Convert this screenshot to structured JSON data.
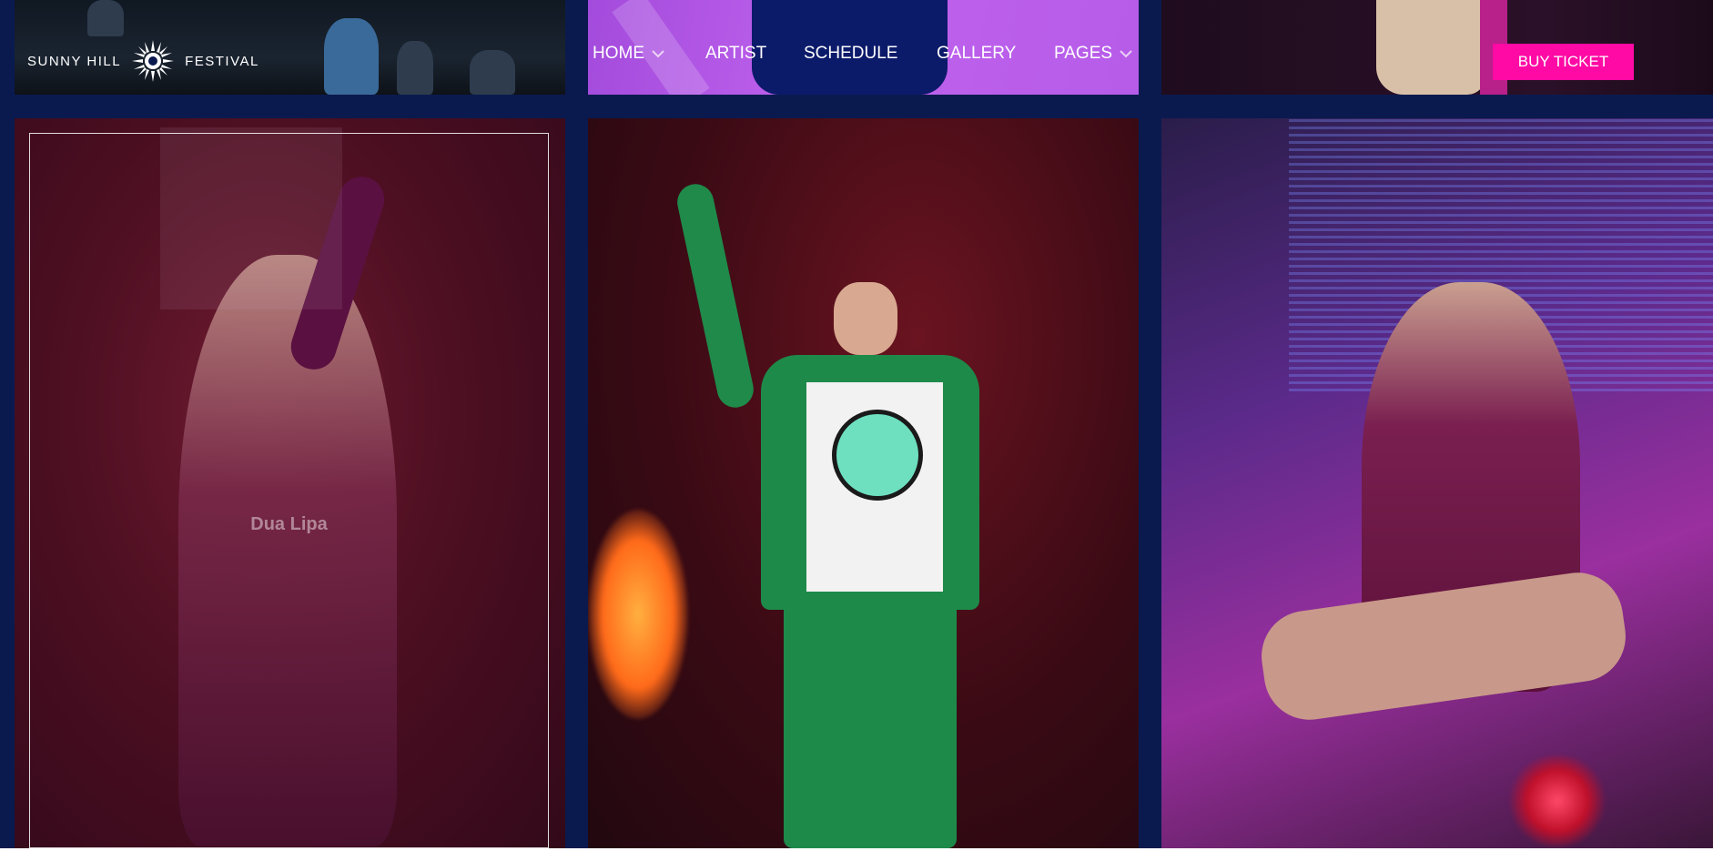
{
  "logo": {
    "left_text": "SUNNY HILL",
    "right_text": "FESTIVAL"
  },
  "nav": {
    "items": [
      {
        "label": "HOME",
        "has_dropdown": true
      },
      {
        "label": "ARTIST",
        "has_dropdown": false
      },
      {
        "label": "SCHEDULE",
        "has_dropdown": false
      },
      {
        "label": "GALLERY",
        "has_dropdown": false
      },
      {
        "label": "PAGES",
        "has_dropdown": true
      }
    ]
  },
  "cta": {
    "label": "BUY TICKET"
  },
  "gallery": {
    "hovered_caption": "Dua Lipa"
  },
  "colors": {
    "accent": "#ff0aa4",
    "frame": "#0a1a4f",
    "text": "#ffffff"
  },
  "icons": {
    "logo_mark": "sun-icon",
    "dropdown": "chevron-down-icon"
  }
}
